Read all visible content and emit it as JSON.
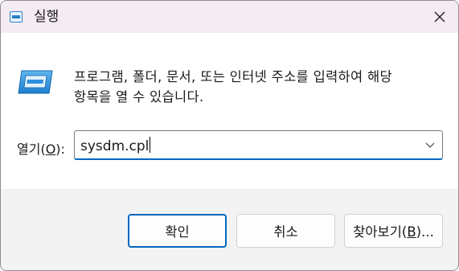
{
  "window": {
    "title": "실행",
    "accent": "#0067c0"
  },
  "icons": {
    "title": "run-app-icon",
    "close": "close-icon",
    "app": "run-dialog-icon",
    "dropdown": "chevron-down-icon"
  },
  "body": {
    "description_line1": "프로그램, 폴더, 문서, 또는 인터넷 주소를 입력하여 해당",
    "description_line2": "항목을 열 수 있습니다.",
    "open_label_prefix": "열기(",
    "open_label_key": "O",
    "open_label_suffix": "):",
    "open_value": "sysdm.cpl"
  },
  "buttons": {
    "ok": "확인",
    "cancel": "취소",
    "browse_prefix": "찾아보기(",
    "browse_key": "B",
    "browse_suffix": ")..."
  }
}
